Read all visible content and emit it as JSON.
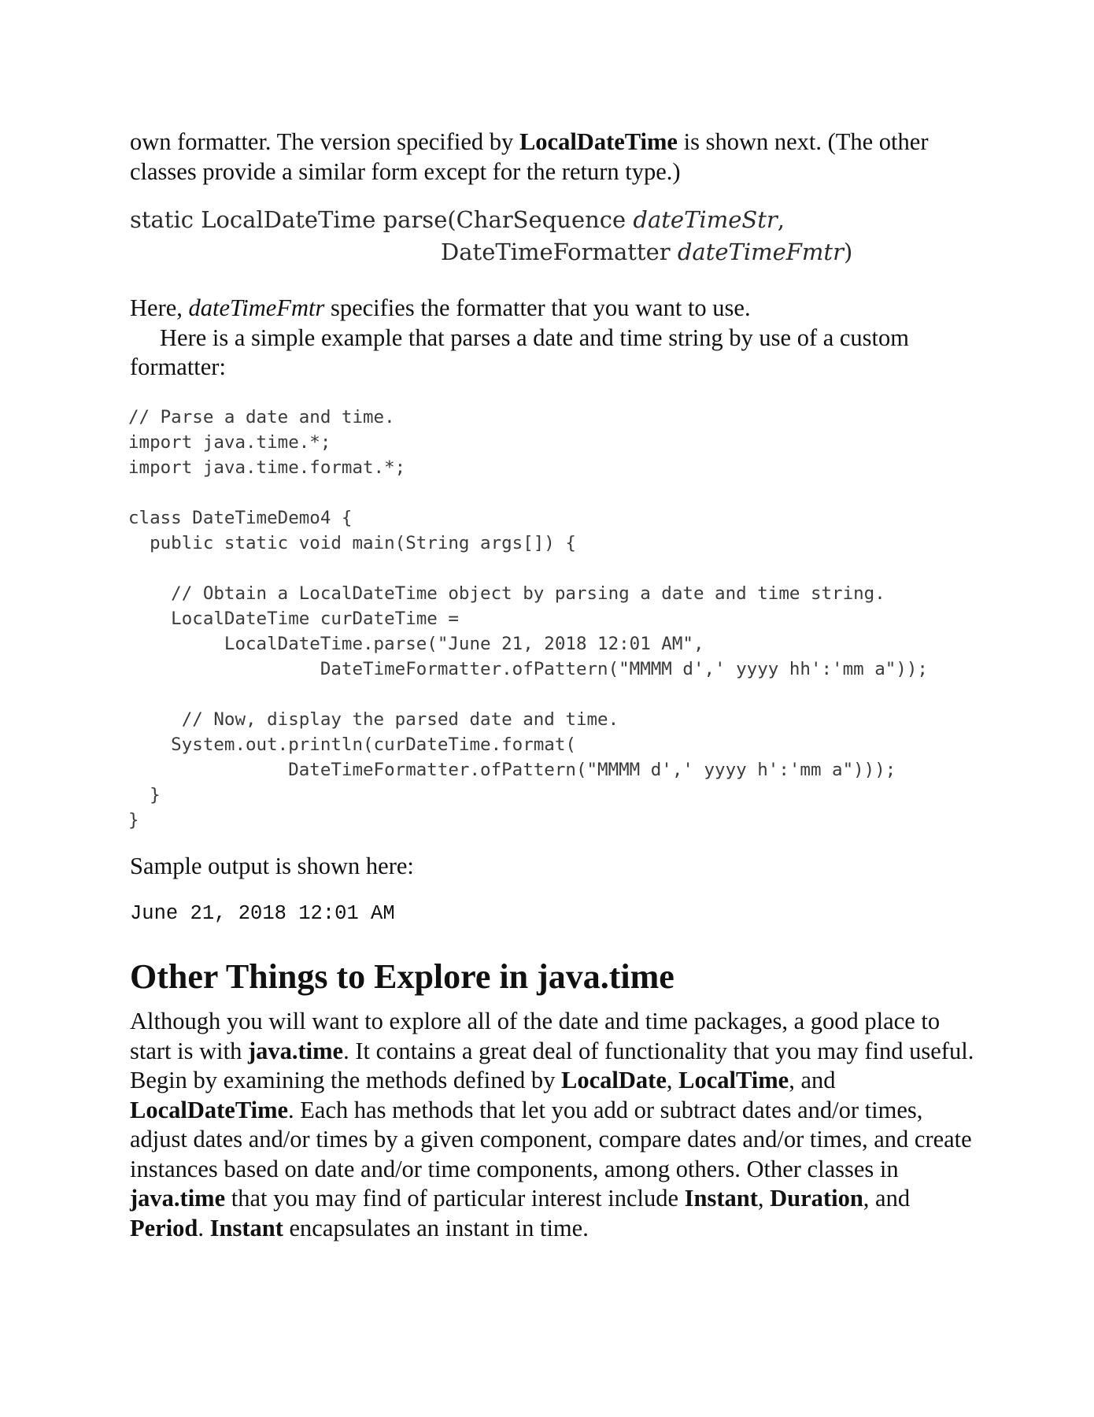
{
  "intro": {
    "p1_a": "own formatter. The version specified by ",
    "p1_b": "LocalDateTime",
    "p1_c": " is shown next. (The other classes provide a similar form except for the return type.)"
  },
  "signature": {
    "line1_a": "static LocalDateTime parse(CharSequence ",
    "line1_b": "dateTimeStr",
    "line1_c": ",",
    "line2_a": "DateTimeFormatter ",
    "line2_b": "dateTimeFmtr",
    "line2_c": ")"
  },
  "here": {
    "a": "Here, ",
    "b": "dateTimeFmtr",
    "c": " specifies the formatter that you want to use."
  },
  "example_intro": "Here is a simple example that parses a date and time string by use of a custom formatter:",
  "code_lines": [
    "// Parse a date and time.",
    "import java.time.*;",
    "import java.time.format.*;",
    "",
    "class DateTimeDemo4 {",
    "  public static void main(String args[]) {",
    "",
    "    // Obtain a LocalDateTime object by parsing a date and time string.",
    "    LocalDateTime curDateTime =",
    "         LocalDateTime.parse(\"June 21, 2018 12:01 AM\",",
    "                  DateTimeFormatter.ofPattern(\"MMMM d',' yyyy hh':'mm a\"));",
    "",
    "     // Now, display the parsed date and time.",
    "    System.out.println(curDateTime.format(",
    "               DateTimeFormatter.ofPattern(\"MMMM d',' yyyy h':'mm a\")));",
    "  }",
    "}"
  ],
  "sample_label": "Sample output is shown here:",
  "sample_output": "June 21, 2018 12:01 AM",
  "heading": "Other Things to Explore in java.time",
  "body": {
    "s1": "Although you will want to explore all of the date and time packages, a good place to start is with ",
    "b1": "java.time",
    "s2": ". It contains a great deal of functionality that you may find useful. Begin by examining the methods defined by ",
    "b2": "LocalDate",
    "s3": ", ",
    "b3": "LocalTime",
    "s4": ", and ",
    "b4": "LocalDateTime",
    "s5": ". Each has methods that let you add or subtract dates and/or times, adjust dates and/or times by a given component, compare dates and/or times, and create instances based on date and/or time components, among others. Other classes in ",
    "b5": "java.time",
    "s6": " that you may find of particular interest include ",
    "b6": "Instant",
    "s7": ", ",
    "b7": "Duration",
    "s8": ", and ",
    "b8": "Period",
    "s9": ". ",
    "b9": "Instant",
    "s10": " encapsulates an instant in time."
  }
}
